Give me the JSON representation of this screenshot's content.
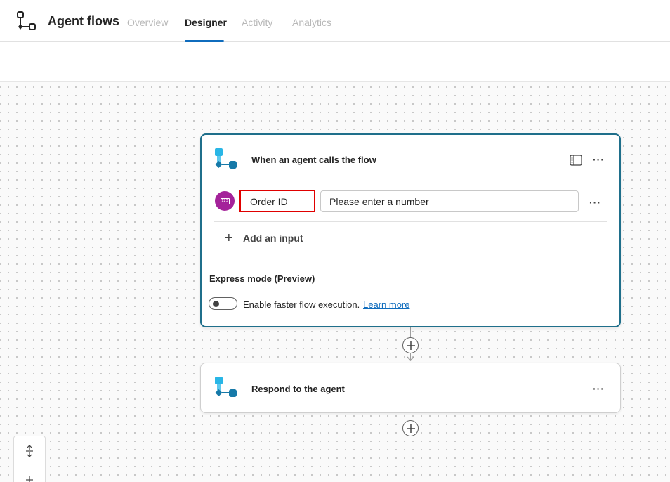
{
  "header": {
    "app_title": "Agent flows",
    "tabs": [
      {
        "label": "Overview",
        "active": false
      },
      {
        "label": "Designer",
        "active": true
      },
      {
        "label": "Activity",
        "active": false
      },
      {
        "label": "Analytics",
        "active": false
      }
    ],
    "app_icon": "flow-icon"
  },
  "trigger_card": {
    "title": "When an agent calls the flow",
    "icon": "agent-flow-icon",
    "panel_icon": "panel-icon",
    "more_label": "···",
    "inputs": [
      {
        "type_icon": "number-icon",
        "name": "Order ID",
        "value": "Please enter a number",
        "more_label": "···"
      }
    ],
    "add_input_label": "Add an input",
    "express_mode": {
      "title": "Express mode (Preview)",
      "toggle_on": false,
      "toggle_label": "Enable faster flow execution.",
      "learn_more": "Learn more"
    }
  },
  "respond_card": {
    "title": "Respond to the agent",
    "icon": "agent-flow-icon",
    "more_label": "···"
  },
  "colors": {
    "accent": "#0f6cbd",
    "trigger_border": "#1f6f8b",
    "number_badge": "#a4229a",
    "highlight_box": "#e00000"
  }
}
